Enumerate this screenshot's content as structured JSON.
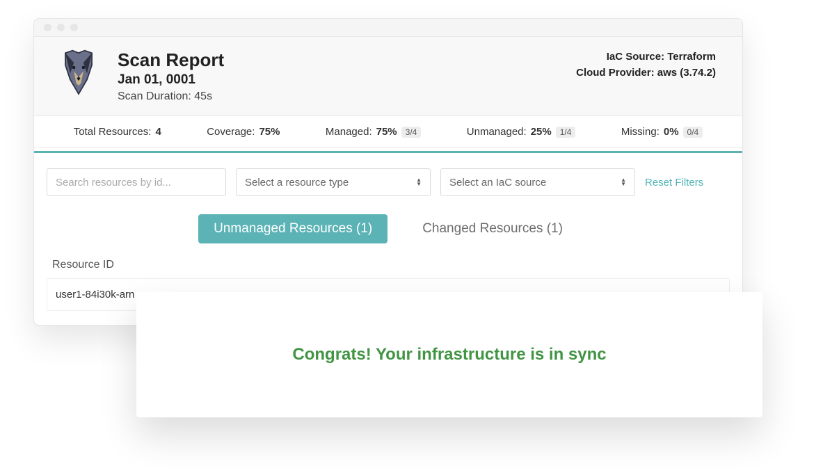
{
  "header": {
    "title": "Scan Report",
    "date": "Jan 01, 0001",
    "duration_label": "Scan Duration: 45s",
    "iac_source": "IaC Source: Terraform",
    "cloud_provider": "Cloud Provider: aws (3.74.2)"
  },
  "stats": {
    "total": {
      "label": "Total Resources:",
      "value": "4"
    },
    "coverage": {
      "label": "Coverage:",
      "value": "75%"
    },
    "managed": {
      "label": "Managed:",
      "value": "75%",
      "chip": "3/4"
    },
    "unmanaged": {
      "label": "Unmanaged:",
      "value": "25%",
      "chip": "1/4"
    },
    "missing": {
      "label": "Missing:",
      "value": "0%",
      "chip": "0/4"
    }
  },
  "filters": {
    "search_placeholder": "Search resources by id...",
    "type_placeholder": "Select a resource type",
    "iac_placeholder": "Select an IaC source",
    "reset_label": "Reset Filters"
  },
  "tabs": {
    "unmanaged": "Unmanaged Resources (1)",
    "changed": "Changed Resources (1)"
  },
  "table": {
    "col_resource_id": "Resource ID",
    "rows": [
      {
        "id": "user1-84i30k-arn"
      }
    ]
  },
  "sync_message": "Congrats! Your infrastructure is in sync"
}
